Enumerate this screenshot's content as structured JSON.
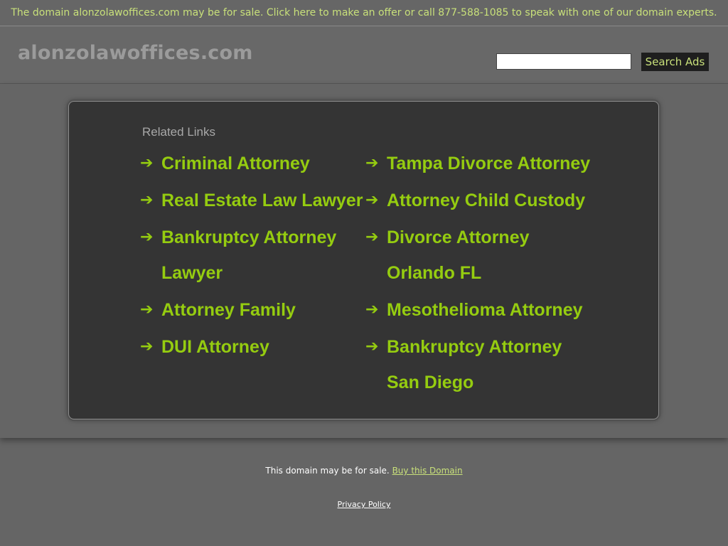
{
  "banner": {
    "text": "The domain alonzolawoffices.com may be for sale. Click here to make an offer or call 877-588-1085 to speak with one of our domain experts."
  },
  "header": {
    "site_title": "alonzolawoffices.com",
    "search_placeholder": "",
    "search_button": "Search Ads"
  },
  "related": {
    "heading": "Related Links",
    "arrow_icon": "arrow-right-icon",
    "left_links": [
      "Criminal Attorney",
      "Real Estate Law Lawyer",
      "Bankruptcy Attorney Lawyer",
      "Attorney Family",
      "DUI Attorney"
    ],
    "right_links": [
      "Tampa Divorce Attorney",
      "Attorney Child Custody",
      "Divorce Attorney Orlando FL",
      "Mesothelioma Attorney",
      "Bankruptcy Attorney San Diego"
    ]
  },
  "footer": {
    "sale_text": "This domain may be for sale.",
    "buy_link": "Buy this Domain",
    "privacy_link": "Privacy Policy"
  },
  "colors": {
    "accent_green": "#95cc10",
    "banner_text": "#c8e07a",
    "background": "#656565",
    "panel": "#343434"
  }
}
